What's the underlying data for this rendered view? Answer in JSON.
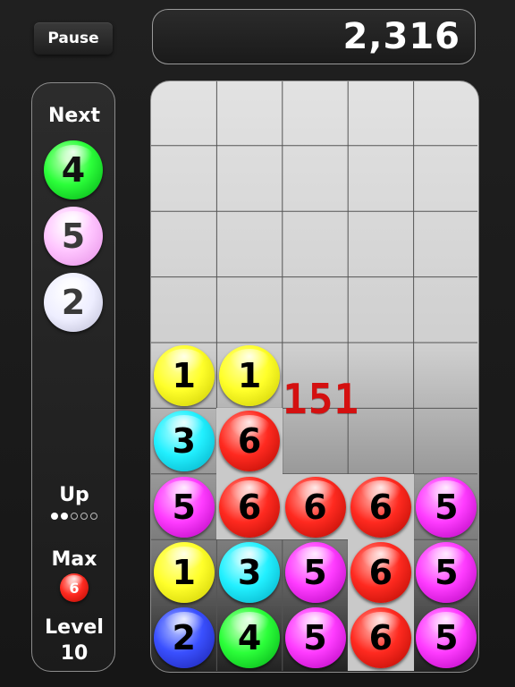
{
  "controls": {
    "pause_label": "Pause"
  },
  "score": {
    "value": "2,316"
  },
  "sidebar": {
    "next_label": "Next",
    "next_balls": [
      {
        "number": "4",
        "color": "green"
      },
      {
        "number": "5",
        "color": "pink"
      },
      {
        "number": "2",
        "color": "white"
      }
    ],
    "up_label": "Up",
    "up_dots": {
      "filled": 2,
      "total": 5
    },
    "max_label": "Max",
    "max_value": "6",
    "level_label": "Level",
    "level_value": "10"
  },
  "board": {
    "columns": 5,
    "rows": 9,
    "combo_popup": "151",
    "balls": [
      {
        "row": 5,
        "col": 0,
        "number": "1",
        "color": "yellow"
      },
      {
        "row": 5,
        "col": 1,
        "number": "1",
        "color": "yellow"
      },
      {
        "row": 6,
        "col": 0,
        "number": "3",
        "color": "cyan"
      },
      {
        "row": 6,
        "col": 1,
        "number": "6",
        "color": "red"
      },
      {
        "row": 7,
        "col": 0,
        "number": "5",
        "color": "magenta"
      },
      {
        "row": 7,
        "col": 1,
        "number": "6",
        "color": "red"
      },
      {
        "row": 7,
        "col": 2,
        "number": "6",
        "color": "red"
      },
      {
        "row": 7,
        "col": 3,
        "number": "6",
        "color": "red"
      },
      {
        "row": 7,
        "col": 4,
        "number": "5",
        "color": "magenta"
      },
      {
        "row": 8,
        "col": 0,
        "number": "1",
        "color": "yellow"
      },
      {
        "row": 8,
        "col": 1,
        "number": "3",
        "color": "cyan"
      },
      {
        "row": 8,
        "col": 2,
        "number": "5",
        "color": "magenta"
      },
      {
        "row": 8,
        "col": 3,
        "number": "6",
        "color": "red"
      },
      {
        "row": 8,
        "col": 4,
        "number": "5",
        "color": "magenta"
      },
      {
        "row": 9,
        "col": 0,
        "number": "2",
        "color": "blue"
      },
      {
        "row": 9,
        "col": 1,
        "number": "4",
        "color": "green"
      },
      {
        "row": 9,
        "col": 2,
        "number": "5",
        "color": "magenta"
      },
      {
        "row": 9,
        "col": 3,
        "number": "6",
        "color": "red"
      },
      {
        "row": 9,
        "col": 4,
        "number": "5",
        "color": "magenta"
      }
    ],
    "highlighted_cells": [
      {
        "row": 6,
        "col": 1
      },
      {
        "row": 7,
        "col": 1
      },
      {
        "row": 7,
        "col": 2
      },
      {
        "row": 7,
        "col": 3
      },
      {
        "row": 8,
        "col": 3
      },
      {
        "row": 9,
        "col": 3
      }
    ]
  },
  "colors": {
    "yellow": "#ffff2a",
    "cyan": "#22f0ff",
    "red": "#ff2a20",
    "magenta": "#ff3cff",
    "blue": "#3a50ff",
    "green": "#2cff3a",
    "pink": "#ffc6ff",
    "white": "#eeeeff",
    "combo_text": "#d41010"
  }
}
